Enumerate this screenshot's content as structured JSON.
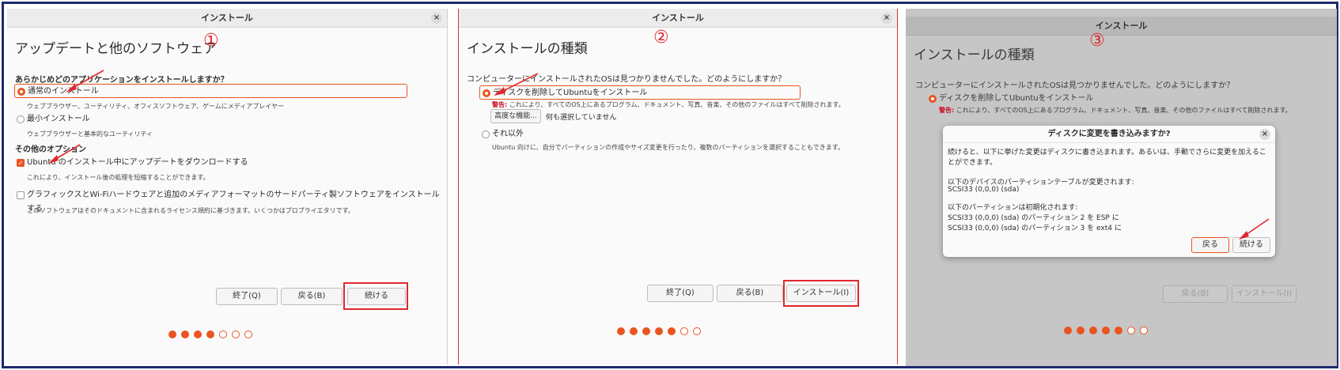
{
  "panel1": {
    "window_title": "インストール",
    "close": "×",
    "heading": "アップデートと他のソフトウェア",
    "step_mark": "①",
    "question": "あらかじめどのアプリケーションをインストールしますか？",
    "normal_install": "通常のインストール",
    "normal_desc": "ウェブブラウザー、ユーティリティ、オフィスソフトウェア、ゲームにメディアプレイヤー",
    "minimal_install": "最小インストール",
    "minimal_desc": "ウェブブラウザーと基本的なユーティリティ",
    "other_options": "その他のオプション",
    "download_updates": "Ubuntu のインストール中にアップデートをダウンロードする",
    "download_desc": "これにより、インストール後の処理を短縮することができます。",
    "third_party": "グラフィックスとWi-Fiハードウェアと追加のメディアフォーマットのサードパーティ製ソフトウェアをインストールする",
    "third_party_desc": "このソフトウェアはそのドキュメントに含まれるライセンス規約に基づきます。いくつかはプロプライエタリです。",
    "quit_button": "終了(Q)",
    "back_button": "戻る(B)",
    "continue_button": "続ける",
    "steps_total": 7,
    "steps_done": 4
  },
  "panel2": {
    "window_title": "インストール",
    "close": "×",
    "heading": "インストールの種類",
    "step_mark": "②",
    "question": "コンピューターにインストールされたOSは見つかりませんでした。どのようにしますか？",
    "erase_option": "ディスクを削除してUbuntuをインストール",
    "warning_label": "警告:",
    "warning_text": " これにより、すべてのOS上にあるプログラム、ドキュメント、写真、音楽、その他のファイルはすべて削除されます。",
    "advanced_button": "高度な機能...",
    "none_selected": "何も選択していません",
    "other_option": "それ以外",
    "other_desc": "Ubuntu 向けに、自分でパーティションの作成やサイズ変更を行ったり、複数のパーティションを選択することもできます。",
    "quit_button": "終了(Q)",
    "back_button": "戻る(B)",
    "install_button": "インストール(I)",
    "steps_total": 7,
    "steps_done": 5
  },
  "panel3": {
    "window_title": "インストール",
    "heading": "インストールの種類",
    "step_mark": "③",
    "question": "コンピューターにインストールされたOSは見つかりませんでした。どのようにしますか？",
    "erase_option": "ディスクを削除してUbuntuをインストール",
    "warning_label": "警告:",
    "warning_text": " これにより、すべてのOS上にあるプログラム、ドキュメント、写真、音楽、その他のファイルはすべて削除されます。",
    "back_button": "戻る(B)",
    "install_button": "インストール(I)",
    "steps_total": 7,
    "steps_done": 5,
    "dialog": {
      "title": "ディスクに変更を書き込みますか?",
      "close": "×",
      "body1": "続けると、以下に挙げた変更はディスクに書き込まれます。あるいは、手動でさらに変更を加えることができます。",
      "table_heading": "以下のデバイスのパーティションテーブルが変更されます:",
      "table_device": "SCSI33 (0,0,0) (sda)",
      "format_heading": "以下のパーティションは初期化されます:",
      "format_item1": "SCSI33 (0,0,0) (sda) のパーティション 2 を ESP に",
      "format_item2": "SCSI33 (0,0,0) (sda) のパーティション 3 を ext4 に",
      "back_button": "戻る",
      "continue_button": "続ける"
    }
  },
  "colors": {
    "accent": "#e95420",
    "annotation_red": "#e0282e",
    "frame_border": "#1f2a6e",
    "warning": "#c7162b"
  }
}
